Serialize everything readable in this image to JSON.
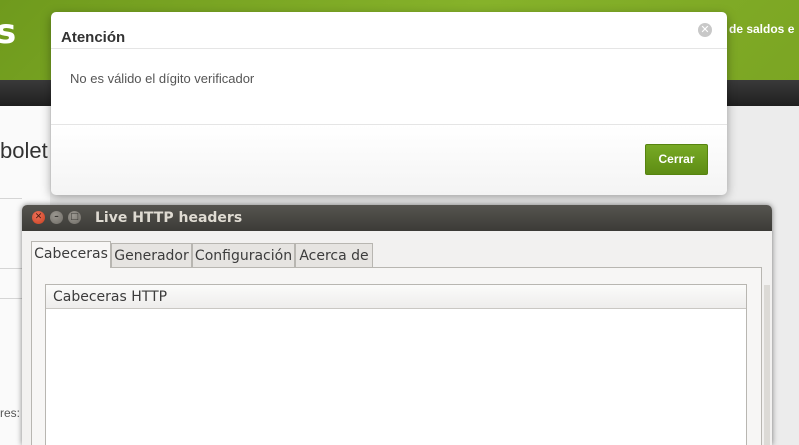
{
  "background_page": {
    "logo_fragment": "s",
    "nav_fragment": "de saldos e",
    "title_fragment": "bolet",
    "snippet_fragment": "res:"
  },
  "modal": {
    "title": "Atención",
    "close_glyph": "✕",
    "message": "No es válido el dígito verificador",
    "button_label": "Cerrar",
    "accent_color": "#6a9a1c"
  },
  "window": {
    "title": "Live HTTP headers",
    "controls": {
      "close": "✕",
      "minimize": "–",
      "maximize": "□"
    },
    "tabs": [
      {
        "label": "Cabeceras",
        "active": true
      },
      {
        "label": "Generador",
        "active": false
      },
      {
        "label": "Configuración",
        "active": false
      },
      {
        "label": "Acerca de",
        "active": false
      }
    ],
    "list": {
      "column_header": "Cabeceras HTTP"
    }
  }
}
